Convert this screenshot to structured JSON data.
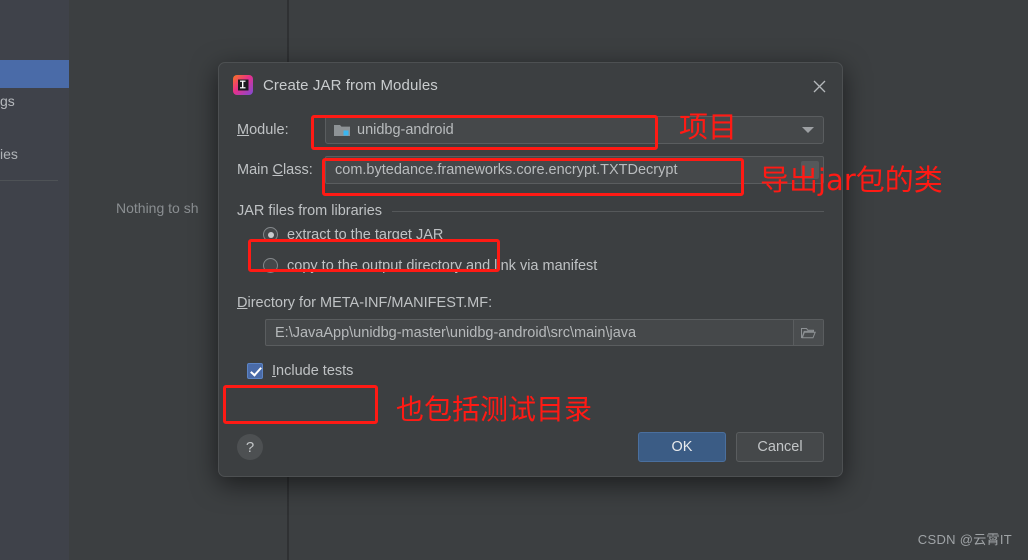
{
  "background": {
    "left_panel": {
      "items": [
        {
          "label": "",
          "selected": true
        },
        {
          "label": "gs"
        },
        {
          "label": "ies"
        }
      ]
    },
    "empty_message": "Nothing to sh",
    "watermark": "CSDN @云霄IT"
  },
  "dialog": {
    "title": "Create JAR from Modules",
    "icon": "intellij-idea-icon",
    "close_icon": "close-icon",
    "module": {
      "label": "Module:",
      "label_mnemonic": "M",
      "label_rest": "odule:",
      "value": "unidbg-android",
      "folder_icon": "module-folder-icon",
      "arrow_icon": "chevron-down-icon"
    },
    "main_class": {
      "label_prefix": "Main ",
      "label_mnemonic": "C",
      "label_rest": "lass:",
      "value": "com.bytedance.frameworks.core.encrypt.TXTDecrypt"
    },
    "jar_libs": {
      "section_title": "JAR files from libraries",
      "options": [
        {
          "prefix": "",
          "mnemonic": "e",
          "rest": "xtract to the target JAR",
          "selected": true
        },
        {
          "prefix": "copy ",
          "mnemonic": "t",
          "rest": "o the output directory and link via manifest",
          "selected": false
        }
      ]
    },
    "directory": {
      "label_mnemonic": "D",
      "label_rest": "irectory for META-INF/MANIFEST.MF:",
      "value": "E:\\JavaApp\\unidbg-master\\unidbg-android\\src\\main\\java",
      "browse_icon": "folder-browse-icon"
    },
    "include_tests": {
      "mnemonic": "I",
      "rest": "nclude tests",
      "checked": true
    },
    "buttons": {
      "help": "?",
      "ok": "OK",
      "cancel": "Cancel"
    }
  },
  "annotations": [
    {
      "id": "project",
      "text": "项目"
    },
    {
      "id": "mainclass",
      "text": "导出jar包的类"
    },
    {
      "id": "include",
      "text": "也包括测试目录"
    }
  ],
  "colors": {
    "accent_blue": "#4a6ba8",
    "annotation_red": "#ff1a14",
    "dialog_bg": "#3c3f41",
    "field_bg": "#45484a"
  }
}
